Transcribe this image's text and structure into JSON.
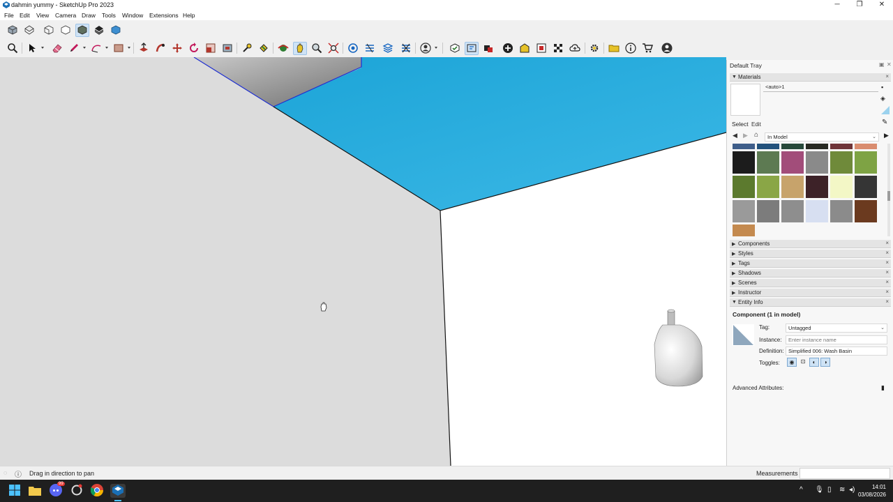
{
  "window": {
    "title": "dahmin yummy - SketchUp Pro 2023",
    "minimize": "─",
    "maximize": "❐",
    "close": "✕"
  },
  "menu": [
    "File",
    "Edit",
    "View",
    "Camera",
    "Draw",
    "Tools",
    "Window",
    "Extensions",
    "Help"
  ],
  "tray": {
    "title": "Default Tray",
    "materials": {
      "title": "Materials",
      "current_name": "<auto>1",
      "tab_select": "Select",
      "tab_edit": "Edit",
      "collection": "In Model",
      "swatch_colors": [
        [
          "#3f5e8a",
          "#23527c",
          "#27493a",
          "#282a22",
          "#6f3438",
          "#d98c6f"
        ],
        [
          "#1c1c1c",
          "#5d7a52",
          "#a24d7a",
          "#8a8a8a",
          "#6f8a3a",
          "#7ea344"
        ],
        [
          "#5c7a2e",
          "#8aa646",
          "#c7a36b",
          "#3d2228",
          "#f3f7c6",
          "#353535"
        ],
        [
          "#9a9a9a",
          "#7c7c7c",
          "#8e8e8e",
          "#d7dff1",
          "#8b8b8b",
          "#6b3a1f"
        ],
        [
          "#c48a4f"
        ]
      ]
    },
    "panels": [
      "Components",
      "Styles",
      "Tags",
      "Shadows",
      "Scenes",
      "Instructor"
    ],
    "entity_info": {
      "title": "Entity Info",
      "heading": "Component (1 in model)",
      "tag_label": "Tag:",
      "tag_value": "Untagged",
      "instance_label": "Instance:",
      "instance_placeholder": "Enter instance name",
      "definition_label": "Definition:",
      "definition_value": "Simplified 006: Wash Basin",
      "toggles_label": "Toggles:",
      "advanced_label": "Advanced Attributes:"
    }
  },
  "status": {
    "message": "Drag in direction to pan",
    "measurements_label": "Measurements"
  },
  "taskbar": {
    "discord_badge": "99",
    "time": "14:01",
    "date": "03/08/2026"
  },
  "colors": {
    "viewport_wall": "#dcdcdc",
    "viewport_floor": "#ffffff",
    "viewport_top": "#28a9d9",
    "accent": "#1e88e5"
  },
  "icons": {
    "toolbar_views": [
      "iso-view-icon",
      "top-view-icon",
      "front-view-icon",
      "right-view-icon",
      "back-view-icon",
      "left-view-icon",
      "bottom-view-icon"
    ],
    "toolbar_main": [
      "zoom-icon",
      "select-icon",
      "eraser-icon",
      "pencil-icon",
      "arc-icon",
      "rectangle-icon",
      "push-pull-icon",
      "follow-me-icon",
      "move-icon",
      "rotate-icon",
      "scale-icon",
      "offset-icon",
      "tape-measure-icon",
      "paint-bucket-icon",
      "orbit-icon",
      "pan-icon",
      "zoom-tool-icon",
      "zoom-extents-icon"
    ]
  }
}
